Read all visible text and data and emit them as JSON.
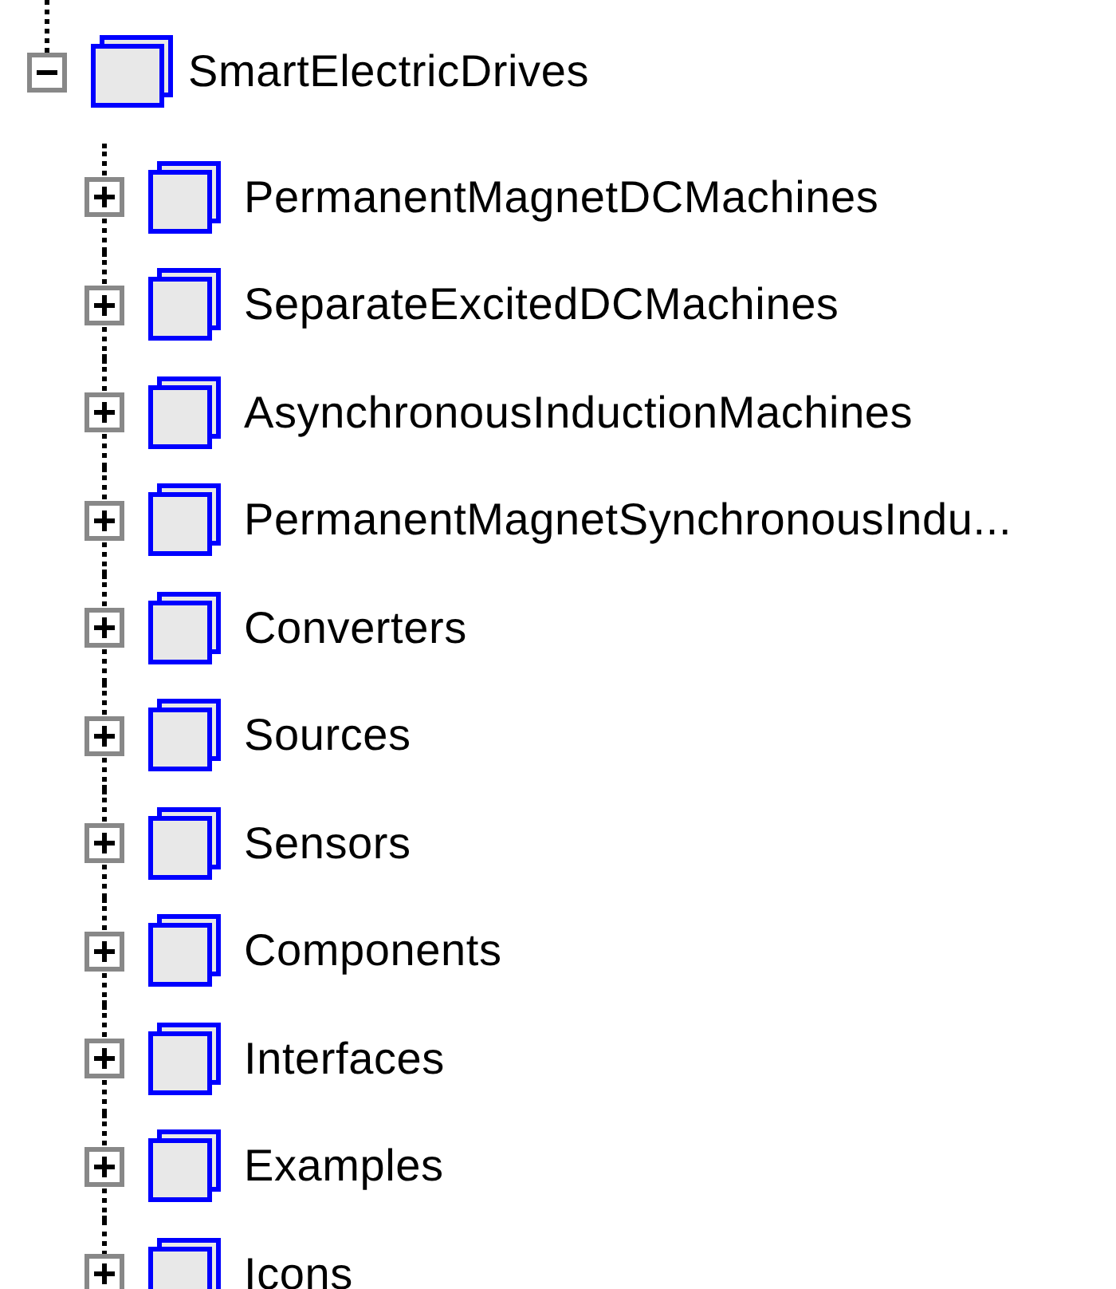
{
  "tree": {
    "label": "SmartElectricDrives",
    "expanded": true,
    "children": [
      {
        "label": "PermanentMagnetDCMachines",
        "expanded": false
      },
      {
        "label": "SeparateExcitedDCMachines",
        "expanded": false
      },
      {
        "label": "AsynchronousInductionMachines",
        "expanded": false
      },
      {
        "label": "PermanentMagnetSynchronousIndu...",
        "expanded": false
      },
      {
        "label": "Converters",
        "expanded": false
      },
      {
        "label": "Sources",
        "expanded": false
      },
      {
        "label": "Sensors",
        "expanded": false
      },
      {
        "label": "Components",
        "expanded": false
      },
      {
        "label": "Interfaces",
        "expanded": false
      },
      {
        "label": "Examples",
        "expanded": false
      },
      {
        "label": "Icons",
        "expanded": false
      }
    ]
  }
}
